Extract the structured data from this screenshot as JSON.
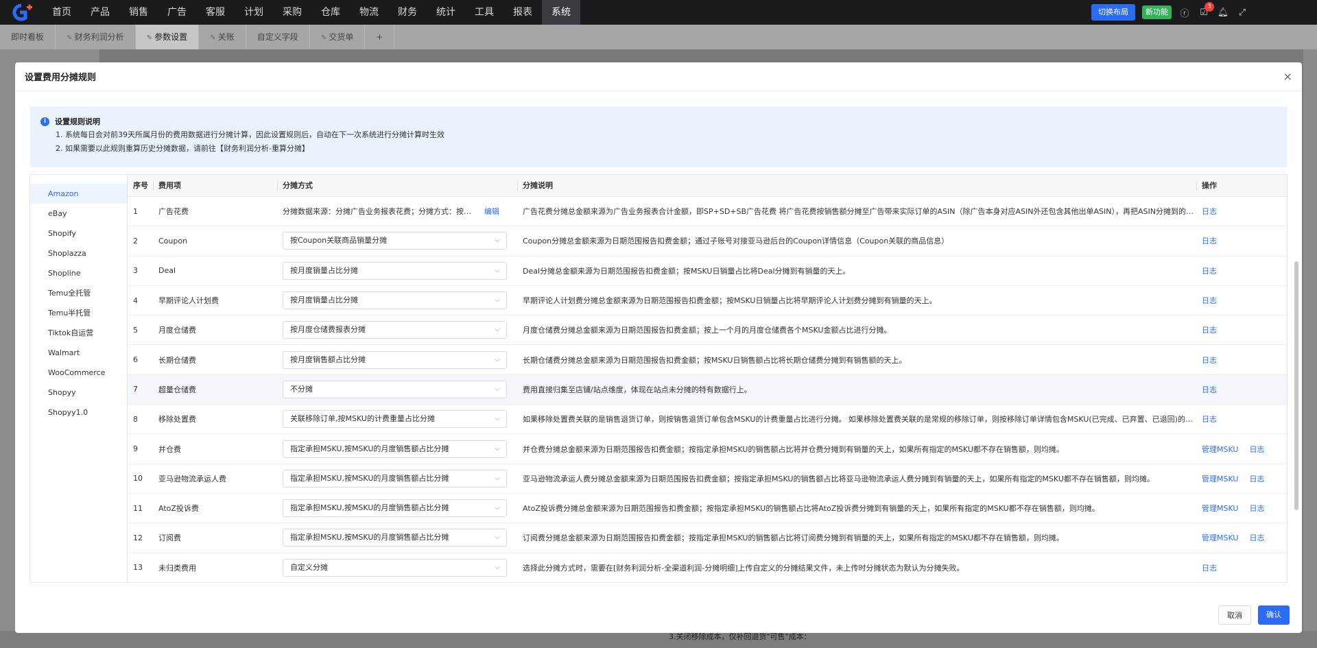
{
  "nav": {
    "items": [
      "首页",
      "产品",
      "销售",
      "广告",
      "客服",
      "计划",
      "采购",
      "仓库",
      "物流",
      "财务",
      "统计",
      "工具",
      "报表",
      "系统"
    ],
    "active": 13,
    "switch_layout": "切换布局",
    "new_feature": "新功能",
    "badge_count": "3"
  },
  "tabs": [
    {
      "label": "即时看板",
      "pin": false
    },
    {
      "label": "财务利润分析",
      "pin": true
    },
    {
      "label": "参数设置",
      "pin": true,
      "active": true
    },
    {
      "label": "关账",
      "pin": true
    },
    {
      "label": "自定义字段",
      "pin": false
    },
    {
      "label": "交货单",
      "pin": true
    },
    {
      "label": "+",
      "pin": false
    }
  ],
  "bg_bottom_text": "3.关闭移除成本，仅补回退货\"可售\"成本：",
  "modal": {
    "title": "设置费用分摊规则",
    "cancel": "取消",
    "confirm": "确认"
  },
  "notice": {
    "title": "设置规则说明",
    "lines": [
      "1. 系统每日会对前39天所属月份的费用数据进行分摊计算，因此设置规则后，自动在下一次系统进行分摊计算时生效",
      "2. 如果需要以此规则重算历史分摊数据，请前往【财务利润分析-重算分摊】"
    ]
  },
  "platforms": [
    "Amazon",
    "eBay",
    "Shopify",
    "Shoplazza",
    "Shopline",
    "Temu全托管",
    "Temu半托管",
    "Tiktok自运营",
    "Walmart",
    "WooCommerce",
    "Shopyy",
    "Shopyy1.0"
  ],
  "table": {
    "headers": [
      "序号",
      "费用项",
      "分摊方式",
      "分摊说明",
      "操作"
    ],
    "rows": [
      {
        "no": "1",
        "item": "广告花费",
        "method": "分摊数据来源：分摊广告业务报表花费；分摊方式：按业务报表花费分摊",
        "edit": "编辑",
        "desc": "广告花费分摊总金额来源为广告业务报表合计金额，即SP+SD+SB广告花费 将广告花费按销售额分摊至广告带来实际订单的ASIN（除广告本身对应ASIN外还包含其他出单ASIN），再把ASIN分摊到的金额按销售额分摊到MSKU",
        "ops": [
          "日志"
        ]
      },
      {
        "no": "2",
        "item": "Coupon",
        "method": "按Coupon关联商品销量分摊",
        "desc": "Coupon分摊总金额来源为日期范围报告扣费金额；通过子账号对接亚马逊后台的Coupon详情信息（Coupon关联的商品信息）",
        "ops": [
          "日志"
        ]
      },
      {
        "no": "3",
        "item": "Deal",
        "method": "按月度销量占比分摊",
        "desc": "Deal分摊总金额来源为日期范围报告扣费金额；按MSKU日销量占比将Deal分摊到有销量的天上。",
        "ops": [
          "日志"
        ]
      },
      {
        "no": "4",
        "item": "早期评论人计划费",
        "method": "按月度销量占比分摊",
        "desc": "早期评论人计划费分摊总金额来源为日期范围报告扣费金额；按MSKU日销量占比将早期评论人计划费分摊到有销量的天上。",
        "ops": [
          "日志"
        ]
      },
      {
        "no": "5",
        "item": "月度仓储费",
        "method": "按月度仓储费报表分摊",
        "desc": "月度仓储费分摊总金额来源为日期范围报告扣费金额；按上一个月的月度仓储费各个MSKU金额占比进行分摊。",
        "ops": [
          "日志"
        ]
      },
      {
        "no": "6",
        "item": "长期仓储费",
        "method": "按月度销售额占比分摊",
        "desc": "长期仓储费分摊总金额来源为日期范围报告扣费金额；按MSKU日销售额占比将长期仓储费分摊到有销售额的天上。",
        "ops": [
          "日志"
        ]
      },
      {
        "no": "7",
        "item": "超量仓储费",
        "method": "不分摊",
        "desc": "费用直接归集至店铺/站点维度，体现在站点未分摊的特有数据行上。",
        "ops": [
          "日志"
        ],
        "highlight": true
      },
      {
        "no": "8",
        "item": "移除处置费",
        "method": "关联移除订单,按MSKU的计费重量占比分摊",
        "desc": "如果移除处置费关联的是销售退货订单，则按销售退货订单包含MSKU的计费重量占比进行分摊。 如果移除处置费关联的是常规的移除订单，则按移除订单详情包含MSKU(已完成、已弃置、已退回)的计费重量占比进行分摊",
        "ops": [
          "日志"
        ]
      },
      {
        "no": "9",
        "item": "并仓费",
        "method": "指定承担MSKU,按MSKU的月度销售额占比分摊",
        "desc": "并仓费分摊总金额来源为日期范围报告扣费金额；按指定承担MSKU的销售额占比将并仓费分摊到有销量的天上，如果所有指定的MSKU都不存在销售额，则均摊。",
        "ops": [
          "管理MSKU",
          "日志"
        ]
      },
      {
        "no": "10",
        "item": "亚马逊物流承运人费",
        "method": "指定承担MSKU,按MSKU的月度销售额占比分摊",
        "desc": "亚马逊物流承运人费分摊总金额来源为日期范围报告扣费金额；按指定承担MSKU的销售额占比将亚马逊物流承运人费分摊到有销量的天上，如果所有指定的MSKU都不存在销售额，则均摊。",
        "ops": [
          "管理MSKU",
          "日志"
        ]
      },
      {
        "no": "11",
        "item": "AtoZ投诉费",
        "method": "指定承担MSKU,按MSKU的月度销售额占比分摊",
        "desc": "AtoZ投诉费分摊总金额来源为日期范围报告扣费金额；按指定承担MSKU的销售额占比将AtoZ投诉费分摊到有销量的天上，如果所有指定的MSKU都不存在销售额，则均摊。",
        "ops": [
          "管理MSKU",
          "日志"
        ]
      },
      {
        "no": "12",
        "item": "订阅费",
        "method": "指定承担MSKU,按MSKU的月度销售额占比分摊",
        "desc": "订阅费分摊总金额来源为日期范围报告扣费金额；按指定承担MSKU的销售额占比将订阅费分摊到有销量的天上，如果所有指定的MSKU都不存在销售额，则均摊。",
        "ops": [
          "管理MSKU",
          "日志"
        ]
      },
      {
        "no": "13",
        "item": "未归类费用",
        "method": "自定义分摊",
        "desc": "选择此分摊方式时，需要在[财务利润分析-全渠道利润-分摊明细]上传自定义的分摊结果文件，未上传时分摊状态为默认为分摊失败。",
        "ops": [
          "日志"
        ]
      }
    ]
  }
}
